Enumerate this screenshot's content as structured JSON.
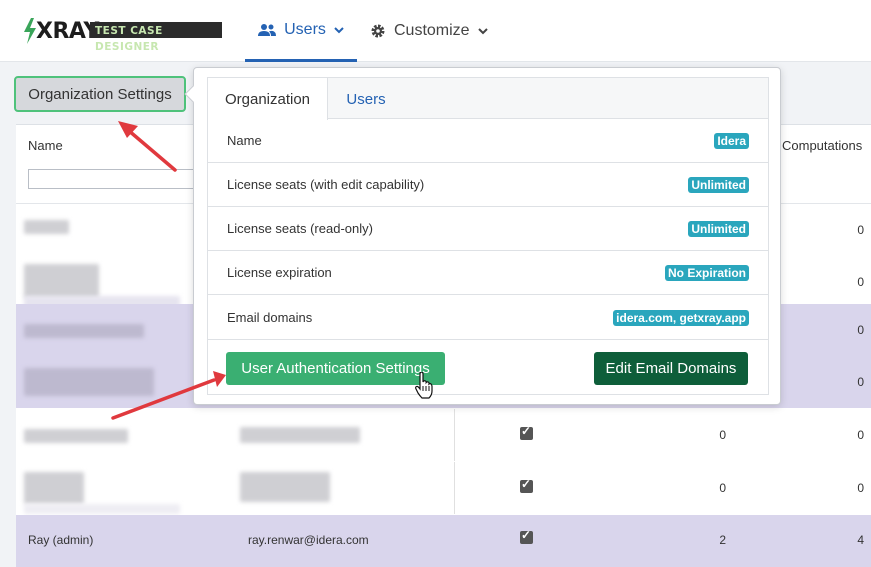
{
  "brand": {
    "name": "XRAY",
    "subtitle": "TEST CASE DESIGNER"
  },
  "nav": {
    "users_label": "Users",
    "customize_label": "Customize"
  },
  "org_settings_button": "Organization Settings",
  "table": {
    "col_name": "Name",
    "col_computations": "Computations",
    "rows": [
      {
        "v1": "",
        "v2": "0",
        "alt": false,
        "check": false
      },
      {
        "v1": "",
        "v2": "0",
        "alt": false,
        "check": false
      },
      {
        "v1": "",
        "v2": "0",
        "alt": true,
        "check": false
      },
      {
        "v1": "",
        "v2": "0",
        "alt": true,
        "check": false
      },
      {
        "v1": "0",
        "v2": "0",
        "alt": false,
        "check": true
      },
      {
        "v1": "0",
        "v2": "0",
        "alt": false,
        "check": true
      }
    ],
    "last_row": {
      "name": "Ray (admin)",
      "email": "ray.renwar@idera.com",
      "v1": "2",
      "v2": "4"
    }
  },
  "popover": {
    "tabs": [
      "Organization",
      "Users"
    ],
    "settings": [
      {
        "label": "Name",
        "value": "Idera"
      },
      {
        "label": "License seats (with edit capability)",
        "value": "Unlimited"
      },
      {
        "label": "License seats (read-only)",
        "value": "Unlimited"
      },
      {
        "label": "License expiration",
        "value": "No Expiration"
      },
      {
        "label": "Email domains",
        "value": "idera.com, getxray.app"
      }
    ],
    "auth_button": "User Authentication Settings",
    "edit_domains_button": "Edit Email Domains"
  },
  "colors": {
    "accent": "#2462b3",
    "badge": "#2aa6bd",
    "auth_button": "#3aaf72",
    "edit_button": "#0e5e3a",
    "arrow": "#e0393e",
    "row_highlight": "#d9d5ec"
  }
}
